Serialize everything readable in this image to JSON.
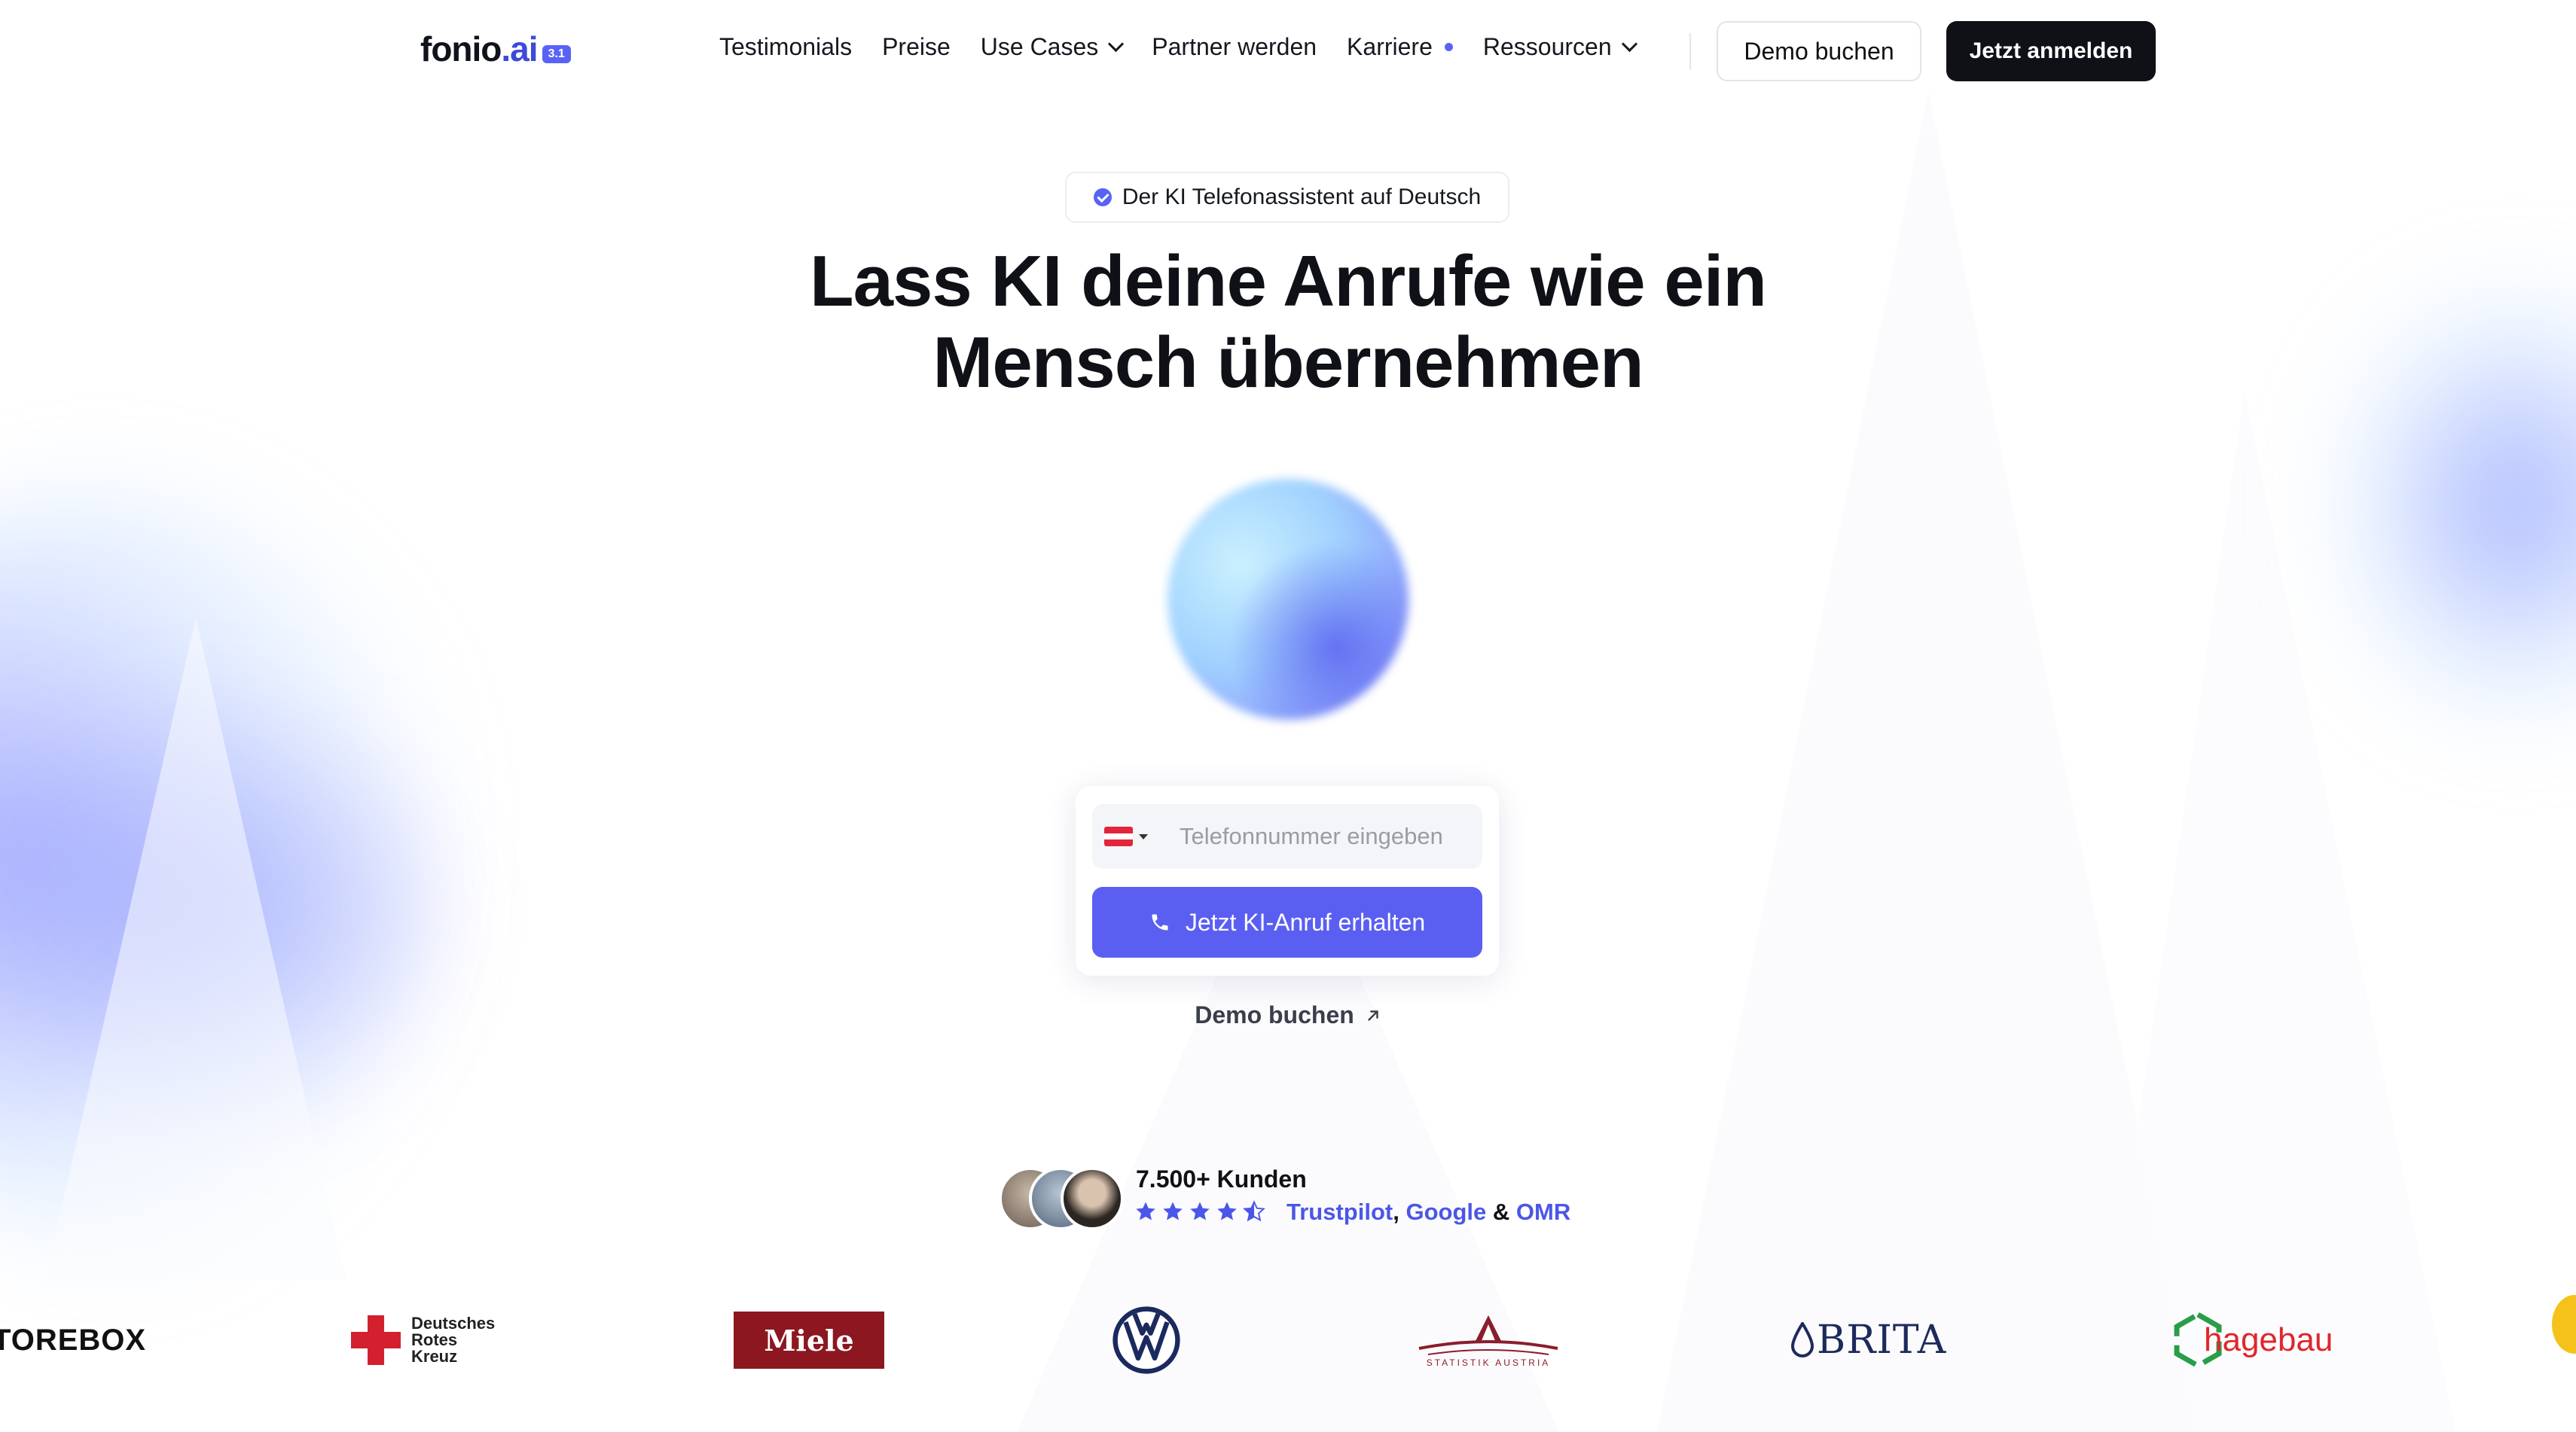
{
  "brand": {
    "name": "fonio",
    "suffix": ".ai",
    "version": "3.1"
  },
  "nav": {
    "links": [
      {
        "label": "Testimonials"
      },
      {
        "label": "Preise"
      },
      {
        "label": "Use Cases"
      },
      {
        "label": "Partner werden"
      },
      {
        "label": "Karriere"
      },
      {
        "label": "Ressourcen"
      }
    ],
    "demo_button": "Demo buchen",
    "signup_button": "Jetzt anmelden"
  },
  "hero": {
    "badge": "Der KI Telefonassistent auf Deutsch",
    "headline_line1": "Lass KI deine Anrufe wie ein",
    "headline_line2": "Mensch übernehmen"
  },
  "form": {
    "country": "AT",
    "phone_placeholder": "Telefonnummer eingeben",
    "phone_value": "",
    "call_button": "Jetzt KI-Anruf erhalten",
    "demo_link": "Demo buchen"
  },
  "social_proof": {
    "customers": "7.500+ Kunden",
    "rating": 4.5,
    "sources": [
      "Trustpilot",
      "Google",
      "OMR"
    ],
    "separator1": ",",
    "separator2": "&"
  },
  "logos": {
    "storebox": "TOREBOX",
    "drk": [
      "Deutsches",
      "Rotes",
      "Kreuz"
    ],
    "miele": "Miele",
    "vw": "VW",
    "statistik": "STATISTIK AUSTRIA",
    "brita": "BRITA",
    "hagebau": "hagebau"
  },
  "colors": {
    "accent": "#5a5ff2",
    "dark": "#0f1117",
    "drk_red": "#d3202f",
    "miele_red": "#8c1721"
  }
}
